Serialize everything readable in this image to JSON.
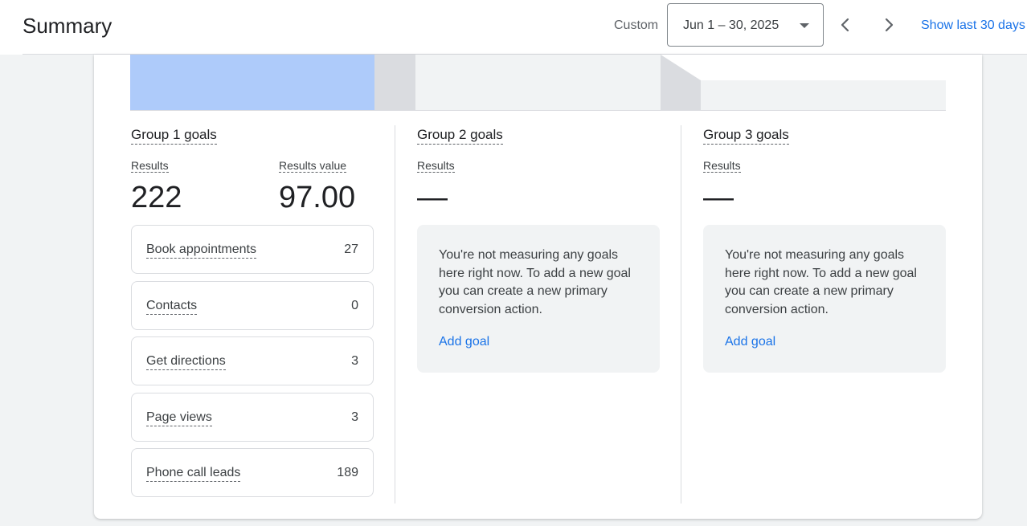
{
  "header": {
    "title": "Summary",
    "range_type": "Custom",
    "date_range": "Jun 1 – 30, 2025",
    "show_last": "Show last 30 days"
  },
  "groups": [
    {
      "title": "Group 1 goals",
      "results_label": "Results",
      "results": "222",
      "results_value_label": "Results value",
      "results_value": "97.00",
      "goals": [
        {
          "name": "Book appointments",
          "count": "27"
        },
        {
          "name": "Contacts",
          "count": "0"
        },
        {
          "name": "Get directions",
          "count": "3"
        },
        {
          "name": "Page views",
          "count": "3"
        },
        {
          "name": "Phone call leads",
          "count": "189"
        }
      ]
    },
    {
      "title": "Group 2 goals",
      "results_label": "Results",
      "results": "—",
      "empty_message": "You're not measuring any goals here right now. To add a new goal you can create a new primary conversion action.",
      "add_goal": "Add goal"
    },
    {
      "title": "Group 3 goals",
      "results_label": "Results",
      "results": "—",
      "empty_message": "You're not measuring any goals here right now. To add a new goal you can create a new primary conversion action.",
      "add_goal": "Add goal"
    }
  ],
  "colors": {
    "accent": "#1a73e8",
    "funnel_active": "#aecbfa",
    "funnel_connector": "#dadce0",
    "funnel_empty": "#f1f3f4"
  },
  "icons": {
    "prev": "chevron-left-icon",
    "next": "chevron-right-icon",
    "dropdown": "arrow-drop-down-icon"
  }
}
